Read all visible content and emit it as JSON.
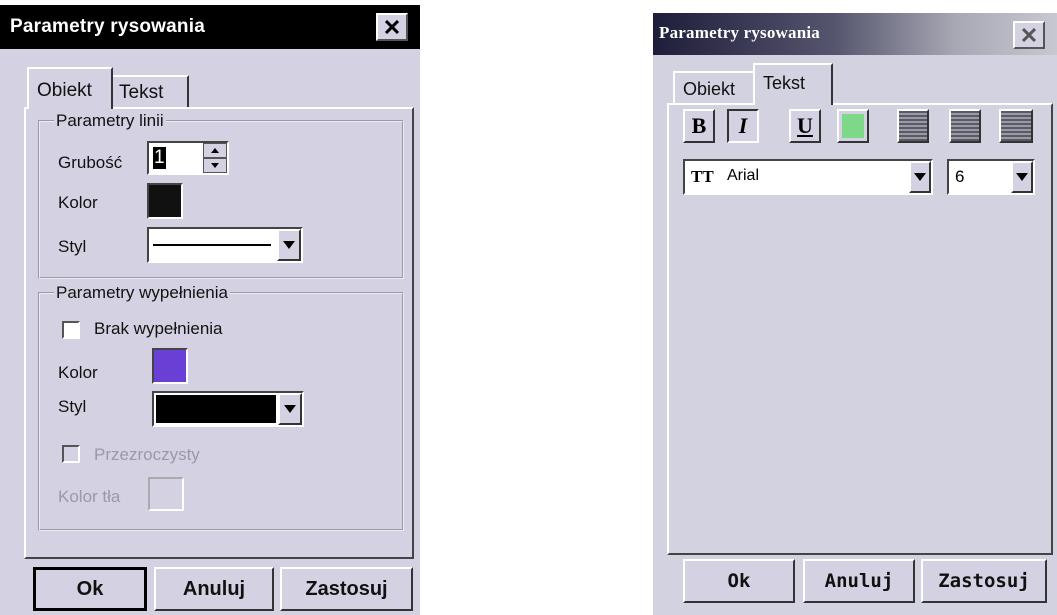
{
  "dialog_left": {
    "title": "Parametry rysowania",
    "tabs": [
      {
        "label": "Obiekt",
        "active": true
      },
      {
        "label": "Tekst",
        "active": false
      }
    ],
    "line_group": {
      "legend": "Parametry linii",
      "thickness_label": "Grubość",
      "thickness_value": "1",
      "color_label": "Kolor",
      "color": "#111111",
      "style_label": "Styl"
    },
    "fill_group": {
      "legend": "Parametry wypełnienia",
      "no_fill_label": "Brak wypełnienia",
      "no_fill_checked": false,
      "color_label": "Kolor",
      "color": "#6a3fd6",
      "style_label": "Styl",
      "style_color": "#000000",
      "transparent_label": "Przezroczysty",
      "bg_color_label": "Kolor tła"
    },
    "buttons": {
      "ok": "Ok",
      "cancel": "Anuluj",
      "apply": "Zastosuj"
    }
  },
  "dialog_right": {
    "title": "Parametry rysowania",
    "tabs": [
      {
        "label": "Obiekt",
        "active": false
      },
      {
        "label": "Tekst",
        "active": true
      }
    ],
    "toolbar": {
      "bold": "B",
      "italic": "I",
      "underline": "U",
      "text_color": "#7ed88a"
    },
    "font_icon": "TT",
    "font_value": "Arial",
    "size_value": "6",
    "buttons": {
      "ok": "Ok",
      "cancel": "Anuluj",
      "apply": "Zastosuj"
    }
  },
  "icons": [
    "close-icon",
    "dropdown-arrow-icon",
    "spin-up-icon",
    "spin-down-icon",
    "font-type-icon",
    "align-left-icon",
    "align-center-icon",
    "align-right-icon"
  ]
}
